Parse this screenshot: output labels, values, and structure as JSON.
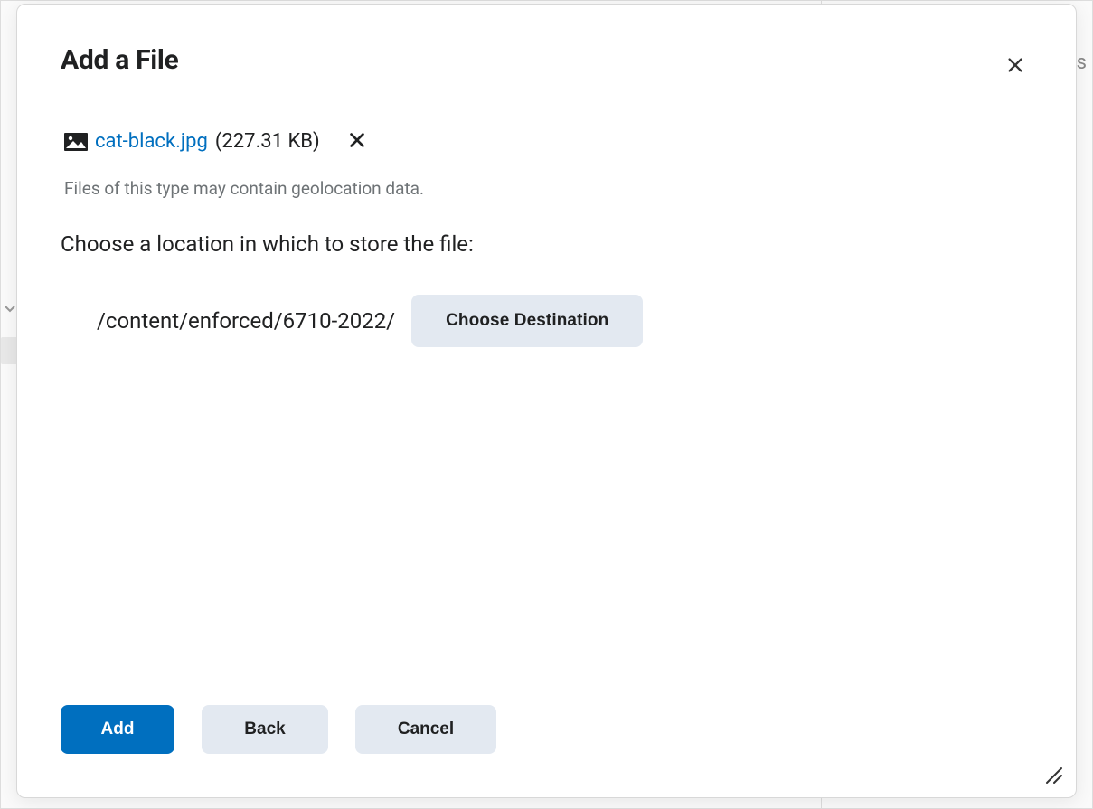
{
  "modal": {
    "title": "Add a File",
    "file": {
      "name": "cat-black.jpg",
      "size": "(227.31 KB)"
    },
    "warning": "Files of this type may contain geolocation data.",
    "location_prompt": "Choose a location in which to store the file:",
    "destination_path": "/content/enforced/6710-2022/",
    "choose_destination_label": "Choose Destination",
    "buttons": {
      "add": "Add",
      "back": "Back",
      "cancel": "Cancel"
    }
  },
  "background": {
    "right_hint": "s"
  }
}
